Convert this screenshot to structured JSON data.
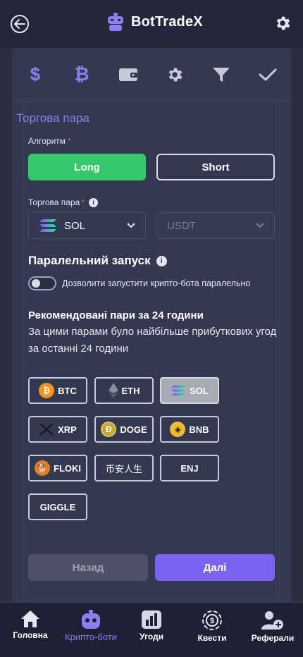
{
  "header": {
    "brand": "BotTradeX"
  },
  "tabs": [
    {
      "name": "dollar-icon"
    },
    {
      "name": "bitcoin-icon"
    },
    {
      "name": "wallet-icon"
    },
    {
      "name": "gear-icon"
    },
    {
      "name": "filter-icon"
    },
    {
      "name": "check-icon"
    }
  ],
  "form": {
    "section_title": "Торгова пара",
    "algorithm_label": "Алгоритм",
    "required_mark": "*",
    "long_label": "Long",
    "short_label": "Short",
    "pair_label": "Торгова пара",
    "base_value": "SOL",
    "quote_value": "USDT",
    "parallel_title": "Паралельний запуск",
    "parallel_toggle_label": "Дозволити запустити крипто-бота паралельно",
    "recommended_title": "Рекомендовані пари за 24 години",
    "recommended_desc": "За цими парами було найбільше прибуткових угод за останні 24 години",
    "back_label": "Назад",
    "next_label": "Далі"
  },
  "pairs": [
    {
      "label": "BTC",
      "icon": "btc-icon"
    },
    {
      "label": "ETH",
      "icon": "eth-icon"
    },
    {
      "label": "SOL",
      "icon": "sol-icon",
      "selected": true
    },
    {
      "label": "XRP",
      "icon": "xrp-icon"
    },
    {
      "label": "DOGE",
      "icon": "doge-icon"
    },
    {
      "label": "BNB",
      "icon": "bnb-icon"
    },
    {
      "label": "FLOKI",
      "icon": "floki-icon"
    },
    {
      "label": "币安人生",
      "icon": ""
    },
    {
      "label": "ENJ",
      "icon": ""
    },
    {
      "label": "GIGGLE",
      "icon": ""
    }
  ],
  "bottom_nav": [
    {
      "label": "Головна",
      "icon": "home-icon"
    },
    {
      "label": "Крипто-боти",
      "icon": "robot-icon",
      "active": true
    },
    {
      "label": "Угоди",
      "icon": "bar-chart-icon"
    },
    {
      "label": "Квести",
      "icon": "dollar-badge-icon"
    },
    {
      "label": "Реферали",
      "icon": "add-user-icon"
    }
  ],
  "colors": {
    "accent": "#8c7ff2",
    "primary_button": "#7a63f0",
    "long_button": "#34c86a",
    "required": "#f0565c"
  }
}
